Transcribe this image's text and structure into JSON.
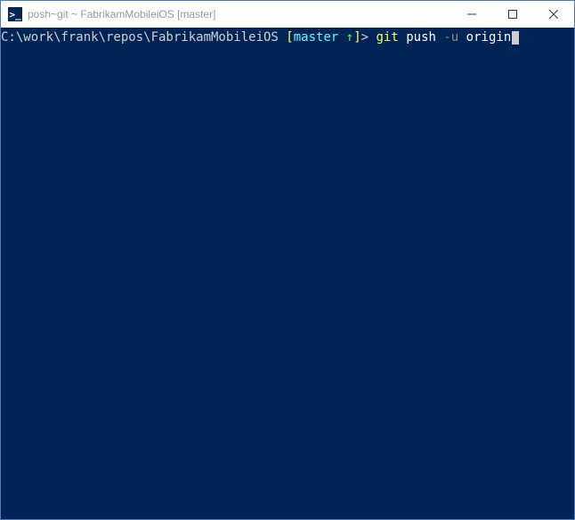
{
  "window": {
    "title": "posh~git ~ FabrikamMobileiOS [master]",
    "icon_glyph": ">_"
  },
  "prompt": {
    "path": "C:\\work\\frank\\repos\\FabrikamMobileiOS",
    "branch": "master",
    "ahead_indicator": "↑",
    "open_bracket": " [",
    "close_bracket": "]",
    "prompt_char": "> ",
    "command": "git",
    "subcommand": "push",
    "flag": "-u",
    "arg": "origin"
  }
}
